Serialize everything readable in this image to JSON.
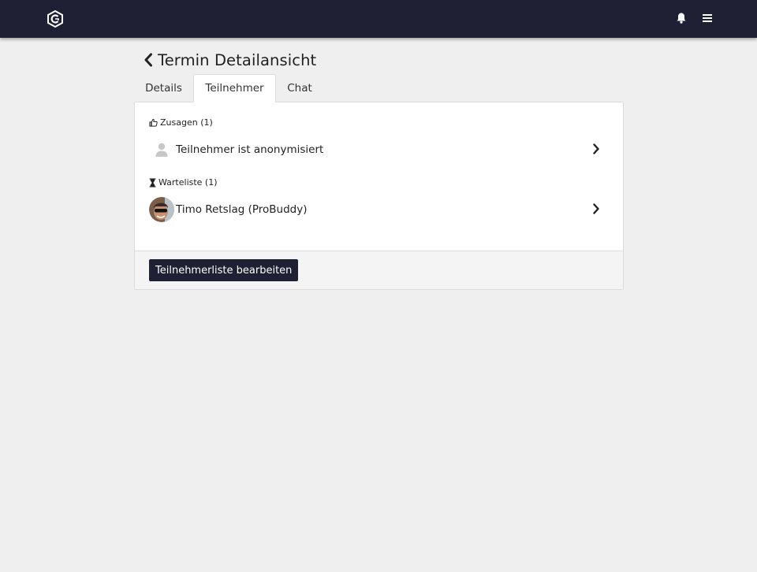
{
  "header": {
    "logo_icon": "brand-logo-icon",
    "notification_icon": "bell-icon",
    "menu_icon": "hamburger-menu-icon",
    "background_color": "#1f2033"
  },
  "page": {
    "title": "Termin Detailansicht",
    "back_icon": "chevron-left-icon"
  },
  "tabs": [
    {
      "label": "Details",
      "active": false
    },
    {
      "label": "Teilnehmer",
      "active": true
    },
    {
      "label": "Chat",
      "active": false
    }
  ],
  "participants": {
    "confirmed": {
      "label": "Zusagen (1)",
      "icon": "thumbs-up-icon",
      "items": [
        {
          "name": "Teilnehmer ist anonymisiert",
          "avatar": "anonymous-user-icon"
        }
      ]
    },
    "waitlist": {
      "label": "Warteliste (1)",
      "icon": "hourglass-icon",
      "items": [
        {
          "name": "Timo Retslag (ProBuddy)",
          "avatar": "user-photo"
        }
      ]
    }
  },
  "footer": {
    "edit_button_label": "Teilnehmerliste bearbeiten"
  }
}
